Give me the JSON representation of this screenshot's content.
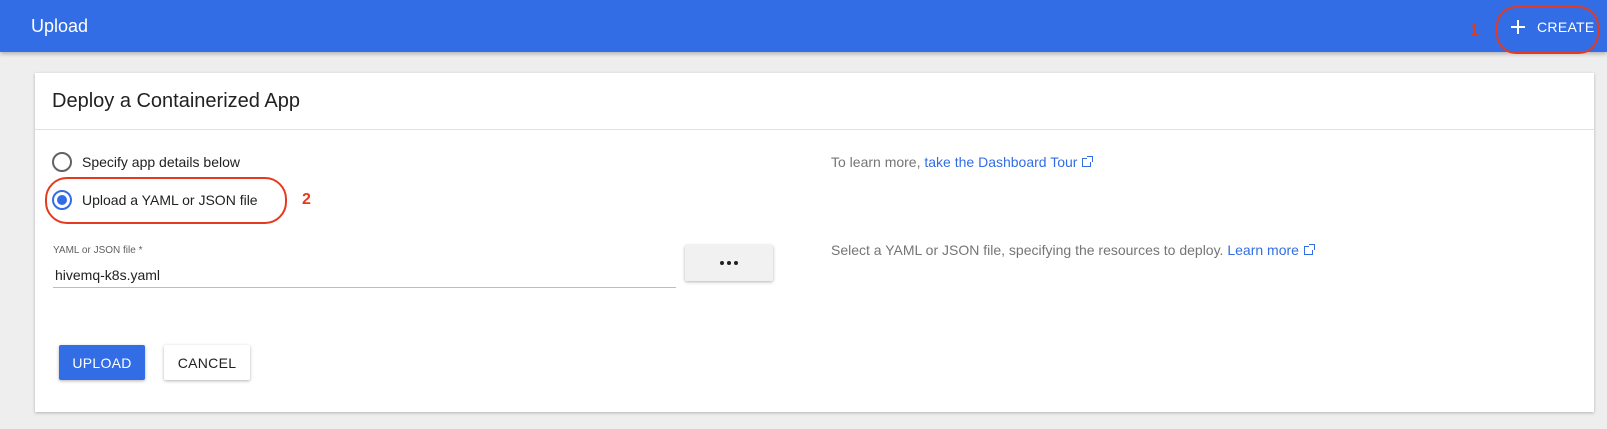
{
  "topbar": {
    "title": "Upload",
    "create_label": "CREATE",
    "create_icon": "plus-icon",
    "color": "#326de6"
  },
  "annotations": {
    "step1": "1",
    "step2": "2",
    "color": "#e53a1e"
  },
  "card": {
    "title": "Deploy a Containerized App",
    "options": [
      {
        "label": "Specify app details below",
        "checked": false
      },
      {
        "label": "Upload a YAML or JSON file",
        "checked": true
      }
    ],
    "help_tour_prefix": "To learn more, ",
    "help_tour_link": "take the Dashboard Tour",
    "file_field": {
      "label": "YAML or JSON file *",
      "value": "hivemq-k8s.yaml"
    },
    "help_file_text": "Select a YAML or JSON file, specifying the resources to deploy. ",
    "help_file_link": "Learn more",
    "upload_label": "UPLOAD",
    "cancel_label": "CANCEL"
  }
}
